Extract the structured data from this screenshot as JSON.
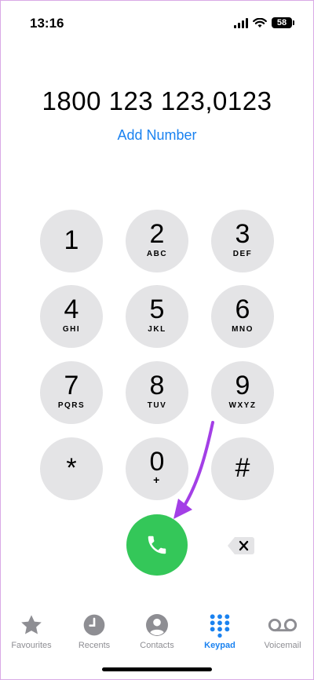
{
  "status": {
    "time": "13:16",
    "battery": "58"
  },
  "dialer": {
    "number": "1800 123 123,0123",
    "add_number": "Add Number",
    "keys": [
      {
        "digit": "1",
        "letters": ""
      },
      {
        "digit": "2",
        "letters": "ABC"
      },
      {
        "digit": "3",
        "letters": "DEF"
      },
      {
        "digit": "4",
        "letters": "GHI"
      },
      {
        "digit": "5",
        "letters": "JKL"
      },
      {
        "digit": "6",
        "letters": "MNO"
      },
      {
        "digit": "7",
        "letters": "PQRS"
      },
      {
        "digit": "8",
        "letters": "TUV"
      },
      {
        "digit": "9",
        "letters": "WXYZ"
      },
      {
        "digit": "*",
        "letters": ""
      },
      {
        "digit": "0",
        "letters": "+"
      },
      {
        "digit": "#",
        "letters": ""
      }
    ]
  },
  "tabs": [
    {
      "label": "Favourites",
      "icon": "star-icon"
    },
    {
      "label": "Recents",
      "icon": "clock-icon"
    },
    {
      "label": "Contacts",
      "icon": "person-circle-icon"
    },
    {
      "label": "Keypad",
      "icon": "keypad-grid-icon",
      "active": true
    },
    {
      "label": "Voicemail",
      "icon": "voicemail-icon"
    }
  ],
  "colors": {
    "accent": "#1a82f0",
    "call_green": "#34c759",
    "key_gray": "#e4e4e6",
    "annotation_arrow": "#a33fe6"
  }
}
